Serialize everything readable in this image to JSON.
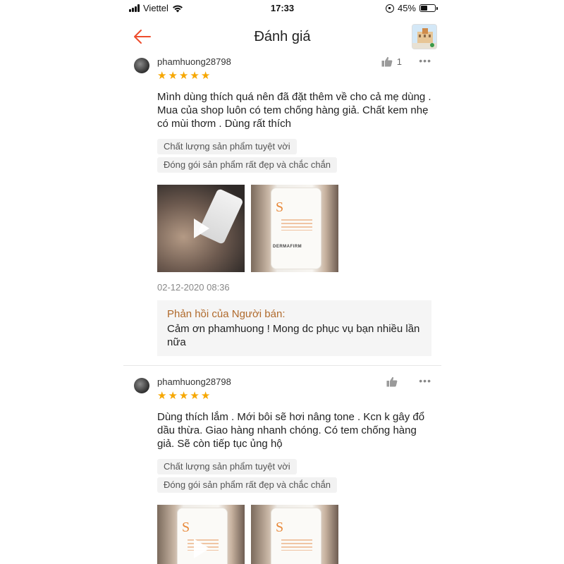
{
  "status_bar": {
    "carrier": "Viettel",
    "time": "17:33",
    "battery": "45%",
    "battery_level": 0.45
  },
  "header": {
    "title": "Đánh giá",
    "back_icon": "arrow-left-icon",
    "accent_color": "#ee4d2d"
  },
  "reviews": [
    {
      "username": "phamhuong28798",
      "rating": 5,
      "like_count": "1",
      "text": "Mình dùng thích quá nên đã đặt thêm về cho cả mẹ dùng . Mua của shop luôn có tem chống hàng giả. Chất kem nhẹ có mùi thơm . Dùng rất thích",
      "tags": [
        "Chất lượng sản phẩm tuyệt vời",
        "Đóng gói sản phẩm rất đẹp và chắc chắn"
      ],
      "timestamp": "02-12-2020 08:36",
      "seller_reply": {
        "title": "Phản hồi của Người bán:",
        "text": "Cảm ơn phamhuong ! Mong dc phục vụ bạn nhiều lần nữa"
      }
    },
    {
      "username": "phamhuong28798",
      "rating": 5,
      "like_count": "",
      "text": "Dùng thích lắm . Mới bôi sẽ hơi nâng tone . Kcn k gây đổ dầu thừa. Giao hàng nhanh chóng. Có tem chống hàng giả. Sẽ còn tiếp tục ủng hộ",
      "tags": [
        "Chất lượng sản phẩm tuyệt vời",
        "Đóng gói sản phẩm rất đẹp và chắc chắn"
      ]
    }
  ],
  "star_color": "#f6a700"
}
